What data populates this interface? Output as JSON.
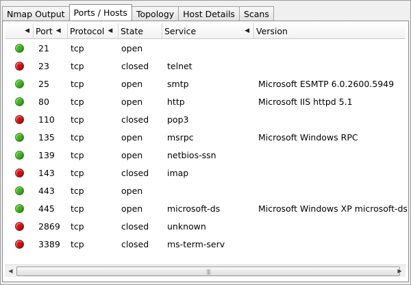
{
  "tabs": [
    {
      "label": "Nmap Output",
      "active": false
    },
    {
      "label": "Ports / Hosts",
      "active": true
    },
    {
      "label": "Topology",
      "active": false
    },
    {
      "label": "Host Details",
      "active": false
    },
    {
      "label": "Scans",
      "active": false
    }
  ],
  "columns": {
    "port": "Port",
    "protocol": "Protocol",
    "state": "State",
    "service": "Service",
    "version": "Version"
  },
  "status_colors": {
    "open": "#42b21f",
    "closed": "#d01212"
  },
  "sort_icon": "triangle-left",
  "rows": [
    {
      "port": "21",
      "protocol": "tcp",
      "state": "open",
      "service": "",
      "version": ""
    },
    {
      "port": "23",
      "protocol": "tcp",
      "state": "closed",
      "service": "telnet",
      "version": ""
    },
    {
      "port": "25",
      "protocol": "tcp",
      "state": "open",
      "service": "smtp",
      "version": "Microsoft ESMTP 6.0.2600.5949"
    },
    {
      "port": "80",
      "protocol": "tcp",
      "state": "open",
      "service": "http",
      "version": "Microsoft IIS httpd 5.1"
    },
    {
      "port": "110",
      "protocol": "tcp",
      "state": "closed",
      "service": "pop3",
      "version": ""
    },
    {
      "port": "135",
      "protocol": "tcp",
      "state": "open",
      "service": "msrpc",
      "version": "Microsoft Windows RPC"
    },
    {
      "port": "139",
      "protocol": "tcp",
      "state": "open",
      "service": "netbios-ssn",
      "version": ""
    },
    {
      "port": "143",
      "protocol": "tcp",
      "state": "closed",
      "service": "imap",
      "version": ""
    },
    {
      "port": "443",
      "protocol": "tcp",
      "state": "open",
      "service": "",
      "version": ""
    },
    {
      "port": "445",
      "protocol": "tcp",
      "state": "open",
      "service": "microsoft-ds",
      "version": "Microsoft Windows XP microsoft-ds"
    },
    {
      "port": "2869",
      "protocol": "tcp",
      "state": "closed",
      "service": "unknown",
      "version": ""
    },
    {
      "port": "3389",
      "protocol": "tcp",
      "state": "closed",
      "service": "ms-term-serv",
      "version": ""
    }
  ]
}
